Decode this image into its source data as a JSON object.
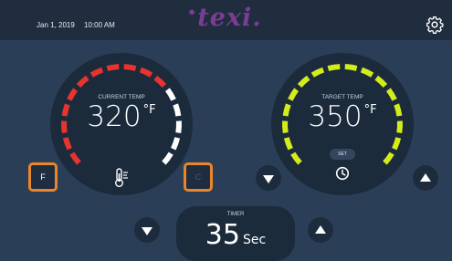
{
  "header": {
    "date": "Jan 1, 2019",
    "time": "10:00 AM",
    "logo_text": "texi.",
    "logo_mark": "•",
    "settings_icon": "gear-icon"
  },
  "current_temp": {
    "label": "CURRENT TEMP",
    "value": "320",
    "unit": "°F",
    "icon": "thermometer-icon",
    "arc_colors": {
      "active": "#e8332f",
      "rest": "#ffffff"
    }
  },
  "target_temp": {
    "label": "TARGET TEMP",
    "value": "350",
    "unit": "°F",
    "set_label": "SET",
    "icon": "clock-icon",
    "arc_color": "#d3ec1c"
  },
  "unit_toggle": {
    "fahrenheit_label": "F",
    "celsius_label": "C",
    "selected": "F",
    "border_color": "#e9862a"
  },
  "timer": {
    "label": "TIMER",
    "value": "35",
    "unit": "Sec"
  },
  "colors": {
    "background": "#2b3e57",
    "topbar": "#1f2d3f",
    "logo": "#7a3d8f"
  }
}
